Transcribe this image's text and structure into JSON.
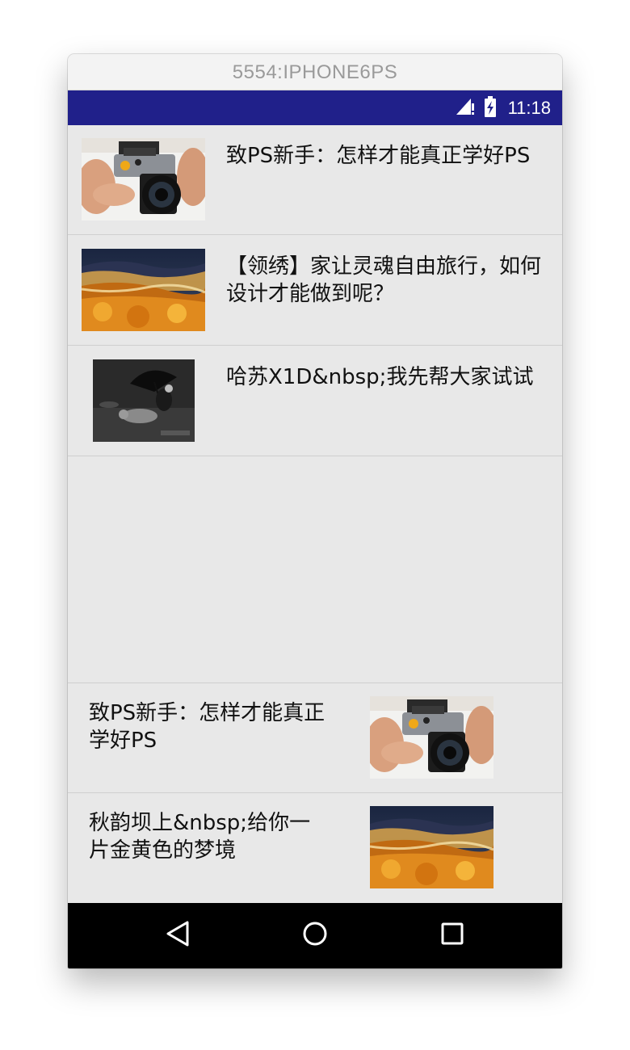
{
  "window": {
    "title": "5554:IPHONE6PS"
  },
  "statusbar": {
    "time": "11:18",
    "signal_icon": "signal-icon",
    "battery_icon": "battery-icon",
    "color": "#20208a"
  },
  "list": {
    "items": [
      {
        "title": "致PS新手：怎样才能真正学好PS",
        "image": "camera-photo"
      },
      {
        "title": "【领绣】家让灵魂自由旅行，如何设计才能做到呢？",
        "image": "autumn-landscape-photo"
      },
      {
        "title": "哈苏X1D&nbsp;我先帮大家试试",
        "image": "umbrella-dog-photo"
      },
      {
        "title": "致PS新手：怎样才能真正学好PS",
        "image": "camera-photo"
      },
      {
        "title": "秋韵坝上&nbsp;给你一片金黄色的梦境",
        "image": "autumn-landscape-photo"
      }
    ]
  },
  "navbar": {
    "back_icon": "back-triangle-icon",
    "home_icon": "home-circle-icon",
    "recents_icon": "recents-square-icon"
  }
}
